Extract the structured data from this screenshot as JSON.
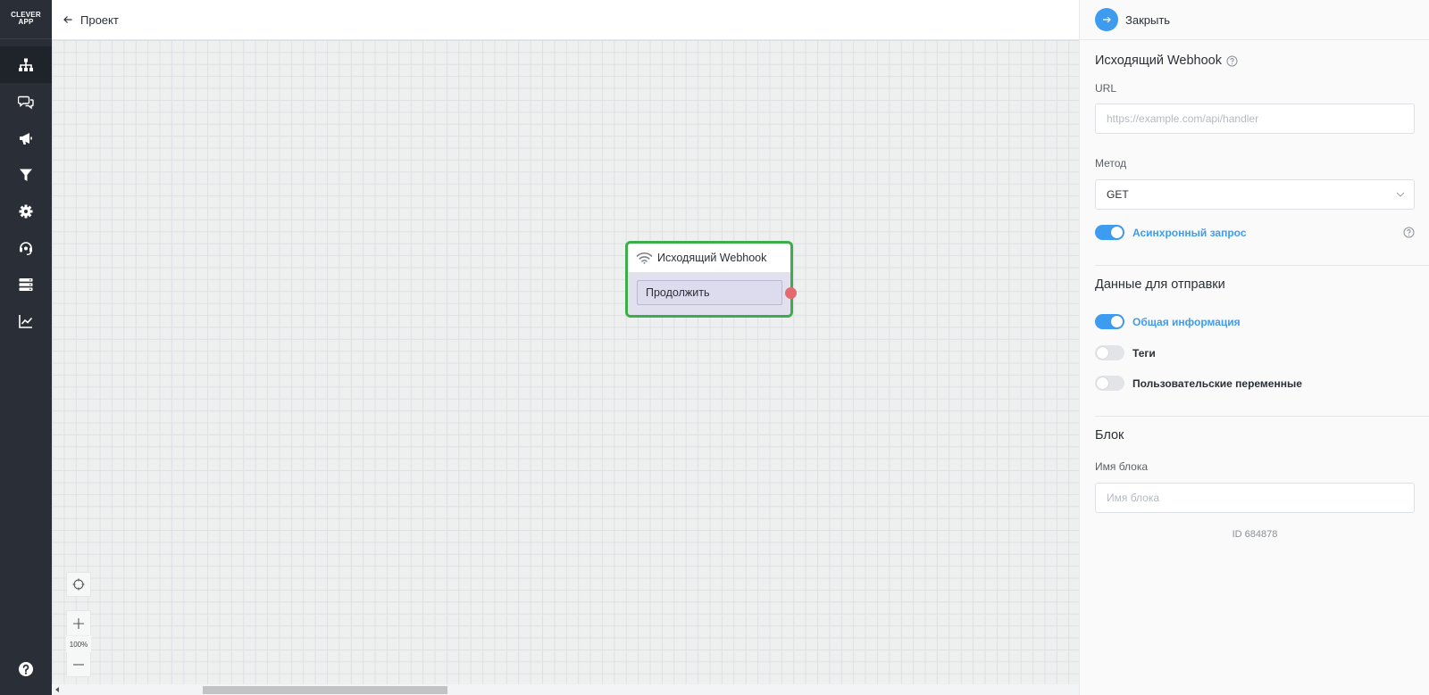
{
  "sidebar": {
    "logo_line1": "CLEVER",
    "logo_line2": "APP",
    "items": [
      {
        "icon": "sitemap-icon",
        "active": true
      },
      {
        "icon": "chat-icon",
        "active": false
      },
      {
        "icon": "megaphone-icon",
        "active": false
      },
      {
        "icon": "filter-icon",
        "active": false
      },
      {
        "icon": "gear-icon",
        "active": false
      },
      {
        "icon": "support-icon",
        "active": false
      },
      {
        "icon": "database-icon",
        "active": false
      },
      {
        "icon": "chart-icon",
        "active": false
      }
    ],
    "help_icon": "help-icon"
  },
  "topbar": {
    "back_label": "Проект"
  },
  "canvas": {
    "node": {
      "title": "Исходящий Webhook",
      "button_label": "Продолжить",
      "icon": "wifi-icon",
      "border_color": "#3cad4a",
      "port_color": "#e56a6f"
    },
    "zoom_label": "100%"
  },
  "panel": {
    "close_label": "Закрыть",
    "section_title": "Исходящий Webhook",
    "url": {
      "label": "URL",
      "value": "",
      "placeholder": "https://example.com/api/handler"
    },
    "method": {
      "label": "Метод",
      "value": "GET"
    },
    "async_toggle": {
      "label": "Асинхронный запрос",
      "on": true
    },
    "send_data": {
      "title": "Данные для отправки",
      "toggles": [
        {
          "label": "Общая информация",
          "on": true
        },
        {
          "label": "Теги",
          "on": false
        },
        {
          "label": "Пользовательские переменные",
          "on": false
        }
      ]
    },
    "block": {
      "title": "Блок",
      "name_label": "Имя блока",
      "name_placeholder": "Имя блока",
      "name_value": "",
      "id_text": "ID 684878"
    },
    "accent_color": "#3e9cf0"
  }
}
